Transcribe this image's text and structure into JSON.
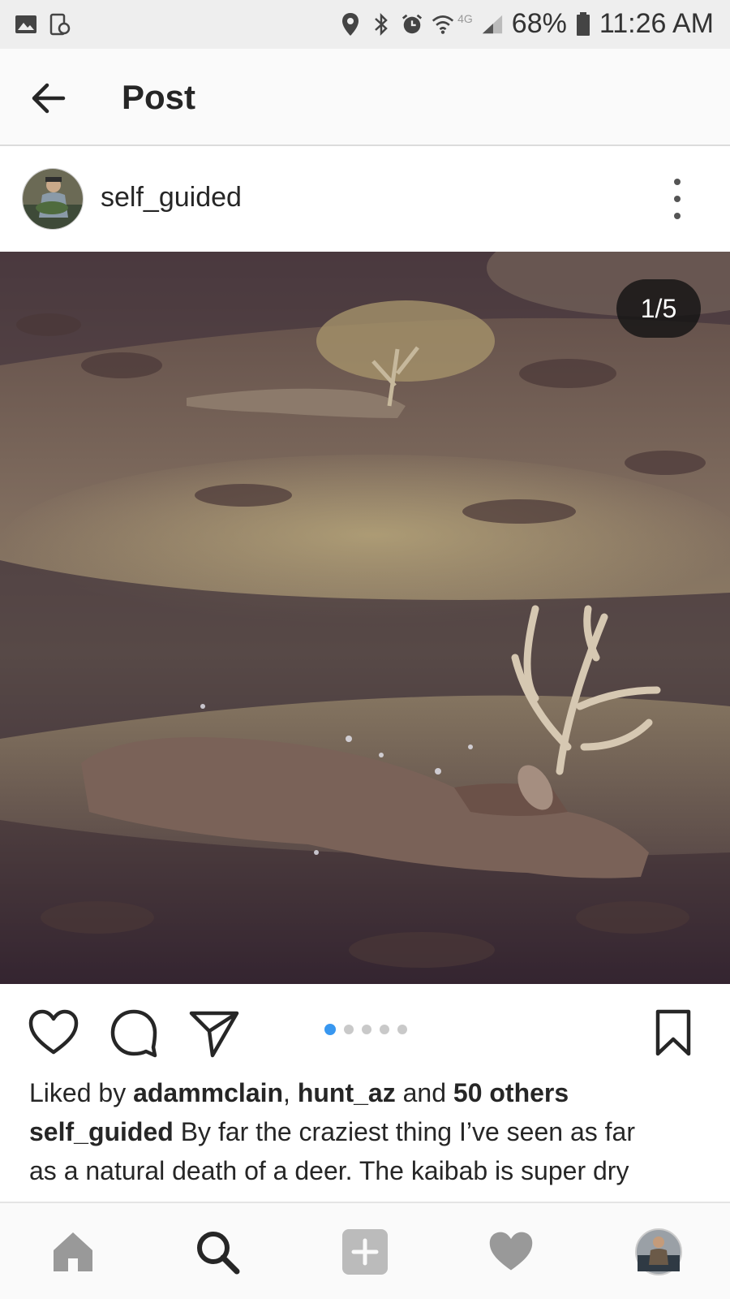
{
  "status_bar": {
    "battery": "68%",
    "time": "11:26 AM",
    "network": "4G",
    "left_icons": [
      "gallery-icon",
      "screen-rotate-icon"
    ],
    "right_icons": [
      "location-icon",
      "bluetooth-icon",
      "alarm-icon",
      "wifi-icon",
      "signal-icon",
      "battery-icon"
    ]
  },
  "header": {
    "title": "Post",
    "back_icon": "arrow-left-icon"
  },
  "post": {
    "username": "self_guided",
    "image_counter": "1/5",
    "carousel": {
      "total": 5,
      "active_index": 0
    },
    "liked_by": {
      "prefix": "Liked by",
      "user1": "adammclain",
      "separator": ",",
      "user2": "hunt_az",
      "conjunction": "and",
      "others": "50 others"
    },
    "caption": {
      "author": "self_guided",
      "line1": "By far the craziest thing I’ve seen as far",
      "line2": "as a natural death of a deer. The kaibab is super dry"
    }
  },
  "actions": [
    "heart-icon",
    "comment-icon",
    "share-icon",
    "bookmark-icon"
  ],
  "bottom_nav": [
    "home-icon",
    "search-icon",
    "add-post-icon",
    "activity-heart-icon",
    "profile-avatar"
  ],
  "colors": {
    "accent_blue": "#3897f0",
    "text": "#262626",
    "header_bg": "#fafafa",
    "status_bg": "#eeeeee"
  }
}
